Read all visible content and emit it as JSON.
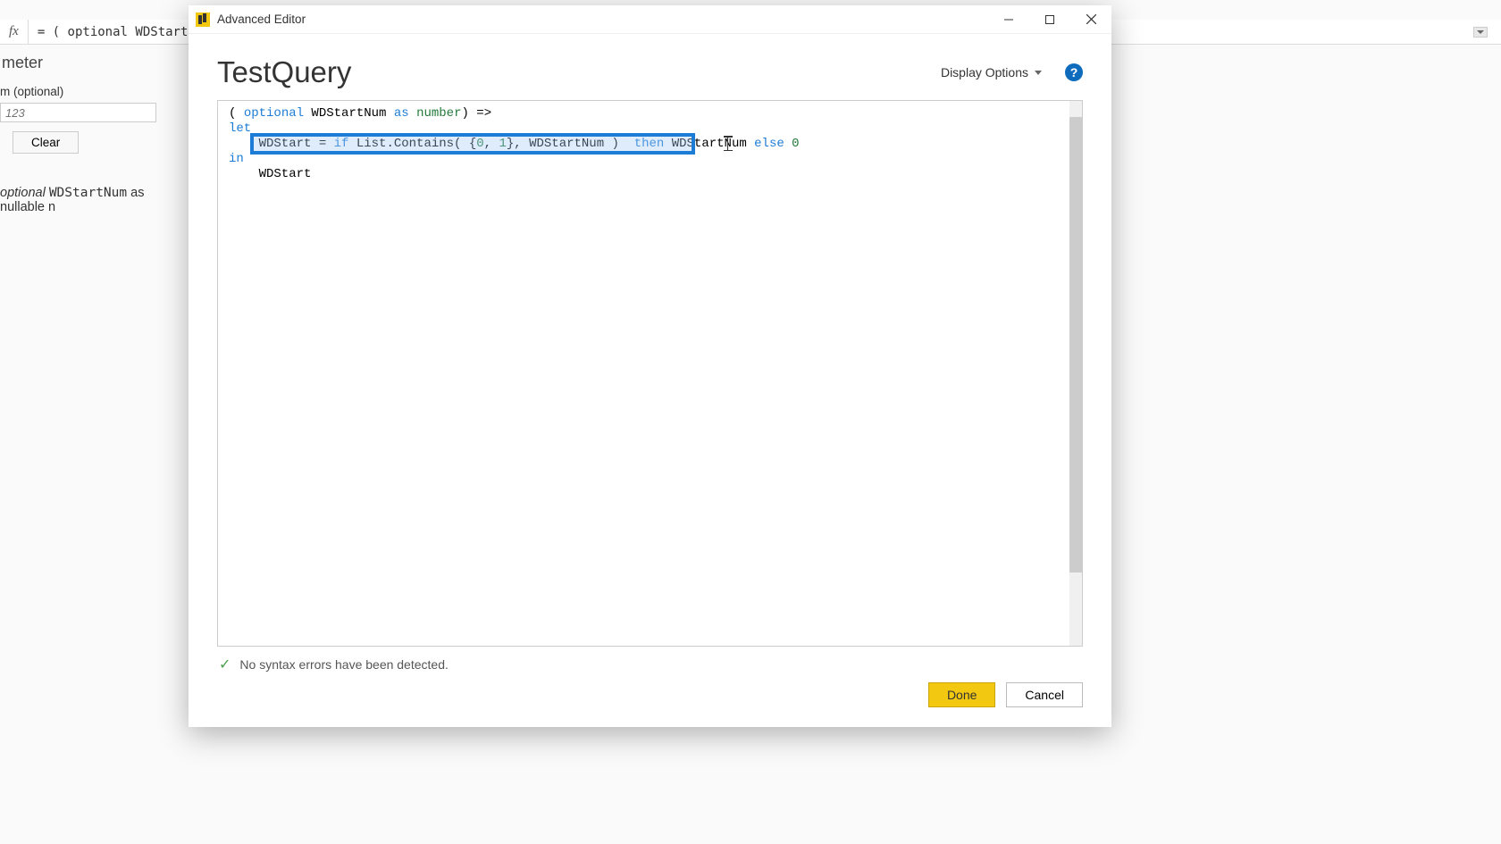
{
  "formula_bar": {
    "fx": "fx",
    "text": "= ( optional WDStartNum a"
  },
  "param_panel": {
    "title": "meter",
    "label": "m (optional)",
    "placeholder": "123",
    "clear_label": "Clear",
    "type_line_prefix": "optional ",
    "type_line_mono": "WDStartNum",
    "type_line_suffix": " as nullable n"
  },
  "dialog": {
    "title": "Advanced Editor",
    "query_name": "TestQuery",
    "display_options_label": "Display Options",
    "code": {
      "line1_paren_open": "( ",
      "line1_optional": "optional",
      "line1_ident": " WDStartNum ",
      "line1_as": "as",
      "line1_number": " number",
      "line1_paren_close": ") =>",
      "line2": "let",
      "line3_pre": "    WDStart = ",
      "line3_if": "if",
      "line3_list": " List.Contains( {",
      "line3_zero": "0",
      "line3_comma": ", ",
      "line3_one": "1",
      "line3_brace": "}, WDStartNum )  ",
      "line3_then": "then",
      "line3_ident2": " WDStartNum ",
      "line3_else": "else",
      "line3_sp": " ",
      "line3_zero2": "0",
      "line4": "in",
      "line5": "    WDStart"
    },
    "status": "No syntax errors have been detected.",
    "done_label": "Done",
    "cancel_label": "Cancel"
  }
}
